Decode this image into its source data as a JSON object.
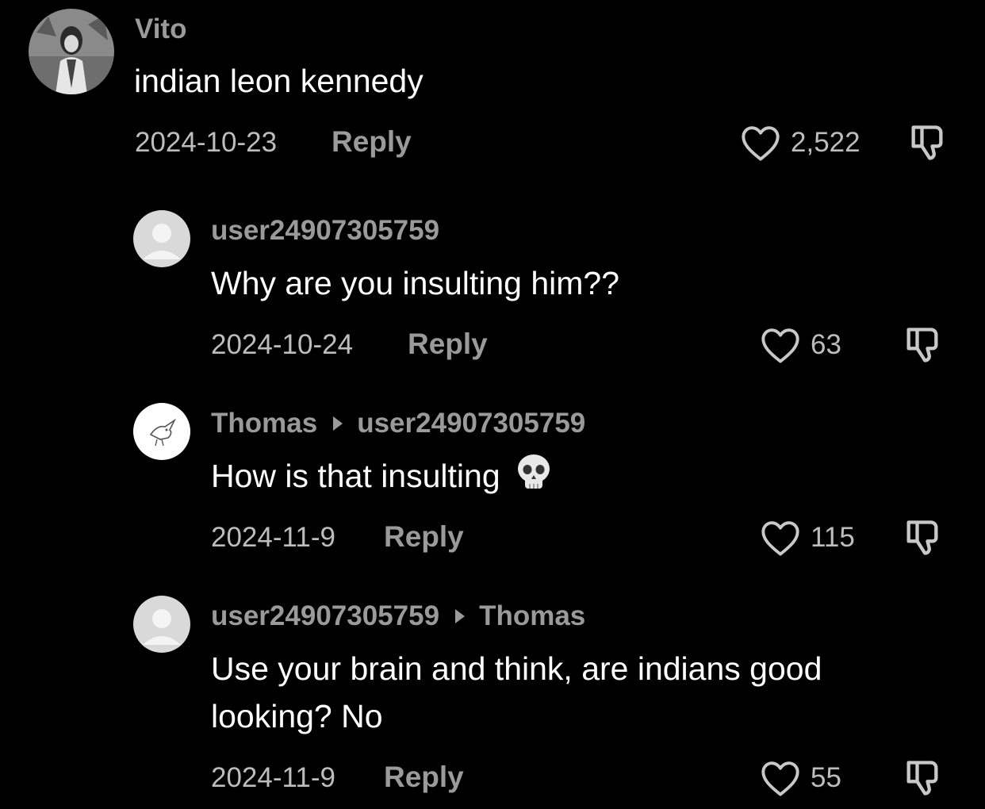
{
  "comments": [
    {
      "author": "Vito",
      "text": "indian leon kennedy",
      "date": "2024-10-23",
      "reply_label": "Reply",
      "likes": "2,522"
    },
    {
      "author": "user24907305759",
      "text": "Why are you insulting him??",
      "date": "2024-10-24",
      "reply_label": "Reply",
      "likes": "63"
    },
    {
      "author": "Thomas",
      "reply_to": "user24907305759",
      "text": "How is that insulting",
      "date": "2024-11-9",
      "reply_label": "Reply",
      "likes": "115"
    },
    {
      "author": "user24907305759",
      "reply_to": "Thomas",
      "text_line1": "Use your brain and think, are indians good",
      "text_line2": "looking? No",
      "date": "2024-11-9",
      "reply_label": "Reply",
      "likes": "55"
    }
  ],
  "icons": {
    "like": "heart-outline-icon",
    "dislike": "thumbs-down-outline-icon",
    "emoji": "skull-emoji"
  },
  "colors": {
    "background": "#000000",
    "username": "#9a9a9a",
    "meta": "#bdbdbd",
    "text": "#ffffff"
  }
}
